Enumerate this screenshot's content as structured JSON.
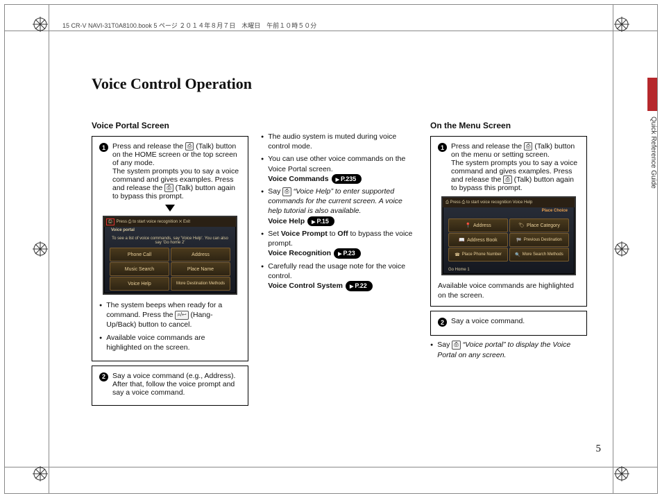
{
  "meta": {
    "header_note": "15 CR-V NAVI-31T0A8100.book  5 ページ  ２０１４年８月７日　木曜日　午前１０時５０分",
    "side_tab_label": "Quick Reference Guide",
    "page_number": "5"
  },
  "title": "Voice Control Operation",
  "col1": {
    "heading": "Voice Portal Screen",
    "step1": {
      "num": "1",
      "line1_pre": "Press and release the ",
      "talk_icon": "⎙",
      "line1_post": " (Talk) button on the HOME screen or the top screen of any mode.",
      "line2": "The system prompts you to say a voice command and gives examples. Press and release the ",
      "line2_post": " (Talk) button again to bypass this prompt."
    },
    "screen1": {
      "top": "Press ⎙ to start voice recognition   ✕ Exit",
      "title": "Voice portal",
      "sub": "To see a list of voice commands, say 'Voice Help'. You can also say 'Go home 2'",
      "c1": "Phone Call",
      "c2": "Address",
      "c3": "Music Search",
      "c4": "Place Name",
      "c5": "Voice Help",
      "c6": "More Destination Methods"
    },
    "b1": "The system beeps when ready for a command. Press the ",
    "b1_icon": "⌕/↩",
    "b1_post": " (Hang-Up/Back) button to cancel.",
    "b2": "Available voice commands are highlighted on the screen.",
    "step2": {
      "num": "2",
      "text": "Say a voice command (e.g., Address). After that, follow the voice prompt and say a voice command."
    }
  },
  "col2": {
    "b1": "The audio system is muted during voice control mode.",
    "b2": "You can use other voice commands on the Voice Portal screen.",
    "b2_label": "Voice Commands",
    "b2_pill": "P.235",
    "b3_pre": "Say ",
    "b3_mid": " “Voice Help” to enter supported commands for the current screen. A voice help tutorial is also available.",
    "b3_label": "Voice Help",
    "b3_pill": "P.15",
    "b4_pre": "Set ",
    "b4_bold1": "Voice Prompt",
    "b4_mid": " to ",
    "b4_bold2": "Off",
    "b4_post": " to bypass the voice prompt.",
    "b4_label": "Voice Recognition",
    "b4_pill": "P.23",
    "b5": "Carefully read the usage note for the voice control.",
    "b5_label": "Voice Control System",
    "b5_pill": "P.22"
  },
  "col3": {
    "heading": "On the Menu Screen",
    "step1": {
      "num": "1",
      "line1_pre": "Press and release the ",
      "line1_post": " (Talk) button on the menu or setting screen.",
      "line2": "The system prompts you to say a voice command and gives examples. Press and release the ",
      "line2_post": " (Talk) button again to bypass this prompt."
    },
    "screen2": {
      "top": "⎙  Press ⎙ to start voice recognition   Voice Help",
      "title": "Place Choice",
      "c1": "Address",
      "c2": "Place Category",
      "c3": "Address Book",
      "c4": "Previous Destination",
      "c5": "Place Phone Number",
      "c6": "More Search Methods",
      "sub": "Go Home 1"
    },
    "s2_caption": "Available voice commands are highlighted on the screen.",
    "step2": {
      "num": "2",
      "text": "Say a voice command."
    },
    "b1_pre": "Say ",
    "b1_mid": " “Voice portal” to display the Voice Portal on any screen."
  }
}
